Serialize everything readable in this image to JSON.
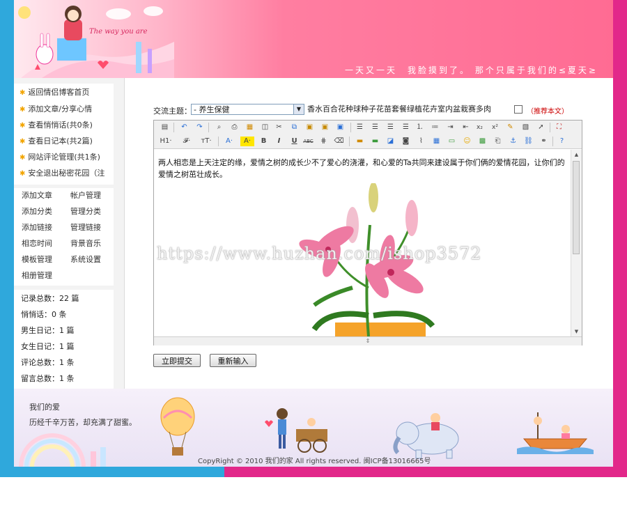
{
  "header": {
    "logo_text": "The way you are",
    "slogan": "一天又一天　我脸摸到了。 那个只属于我们的≤夏天≥"
  },
  "sidebar": {
    "menu": [
      {
        "label": "返回情侣博客首页"
      },
      {
        "label": "添加文章/分享心情"
      },
      {
        "label": "查看悄悄话(共0条)"
      },
      {
        "label": "查看日记本(共2篇)"
      },
      {
        "label": "网站评论管理(共1条)"
      },
      {
        "label": "安全退出秘密花园（注"
      }
    ],
    "admin_left": [
      "添加文章",
      "添加分类",
      "添加链接",
      "相恋时间",
      "模板管理",
      "相册管理"
    ],
    "admin_right": [
      "帐户管理",
      "管理分类",
      "管理链接",
      "背景音乐",
      "系统设置"
    ],
    "stats": [
      "记录总数：22 篇",
      "悄悄话：0 条",
      "男生日记：1 篇",
      "女生日记：1 篇",
      "评论总数：1 条",
      "留言总数：1 条"
    ]
  },
  "form": {
    "topic_label": "交流主题：",
    "category_selected": "- 养生保健",
    "title_value": "香水百合花种球种子花苗套餐绿植花卉室内盆栽赛多肉",
    "recommend_label": "（推荐本文）",
    "submit_label": "立即提交",
    "reset_label": "重新输入"
  },
  "editor": {
    "body_text": "两人相恋是上天注定的缘，爱情之树的成长少不了爱心的浇灌，和心爱的Ta共同来建设属于你们俩的爱情花园，让你们的爱情之树茁壮成长。",
    "toolbar_row1": [
      "source-icon",
      "undo-icon",
      "redo-icon",
      "preview-icon",
      "print-icon",
      "template-icon",
      "new-icon",
      "cut-icon",
      "copy-icon",
      "paste-icon",
      "paste-text-icon",
      "paste-word-icon",
      "align-left-icon",
      "align-center-icon",
      "align-right-icon",
      "align-justify-icon",
      "ordered-list-icon",
      "unordered-list-icon",
      "indent-icon",
      "outdent-icon",
      "subscript-icon",
      "superscript-icon",
      "clear-format-icon",
      "select-all-icon",
      "select-icon",
      "fullscreen-icon"
    ],
    "toolbar_row2": [
      "heading-icon",
      "font-family-icon",
      "font-size-icon",
      "text-color-icon",
      "highlight-icon",
      "bold-icon",
      "italic-icon",
      "underline-icon",
      "strikethrough-icon",
      "line-height-icon",
      "eraser-icon",
      "image-icon",
      "multi-image-icon",
      "flash-icon",
      "media-icon",
      "insert-file-icon",
      "table-icon",
      "hr-icon",
      "emoticon-icon",
      "map-icon",
      "pagebreak-icon",
      "anchor-icon",
      "link-icon",
      "unlink-icon",
      "help-icon"
    ],
    "glyphs": {
      "heading": "H1·",
      "font_family": "𝓕·",
      "font_size": "тT·",
      "text_color": "A·",
      "highlight": "A·",
      "bold": "B",
      "italic": "I",
      "underline": "U",
      "strike": "ABC",
      "sub": "x₂",
      "sup": "x²"
    }
  },
  "watermark": "https://www.huzhan.com/ishop3572",
  "footer": {
    "love_title": "我们的爱",
    "love_sub": "历经千辛万苦，却充满了甜蜜。",
    "copyright": "CopyRight © 2010 我们的家 All rights reserved.  闽ICP备13016665号"
  },
  "colors": {
    "frame_left": "#2fa8dc",
    "frame_right": "#e2288a",
    "header_pink": "#ff6b93",
    "recommend_red": "#cc0000"
  }
}
